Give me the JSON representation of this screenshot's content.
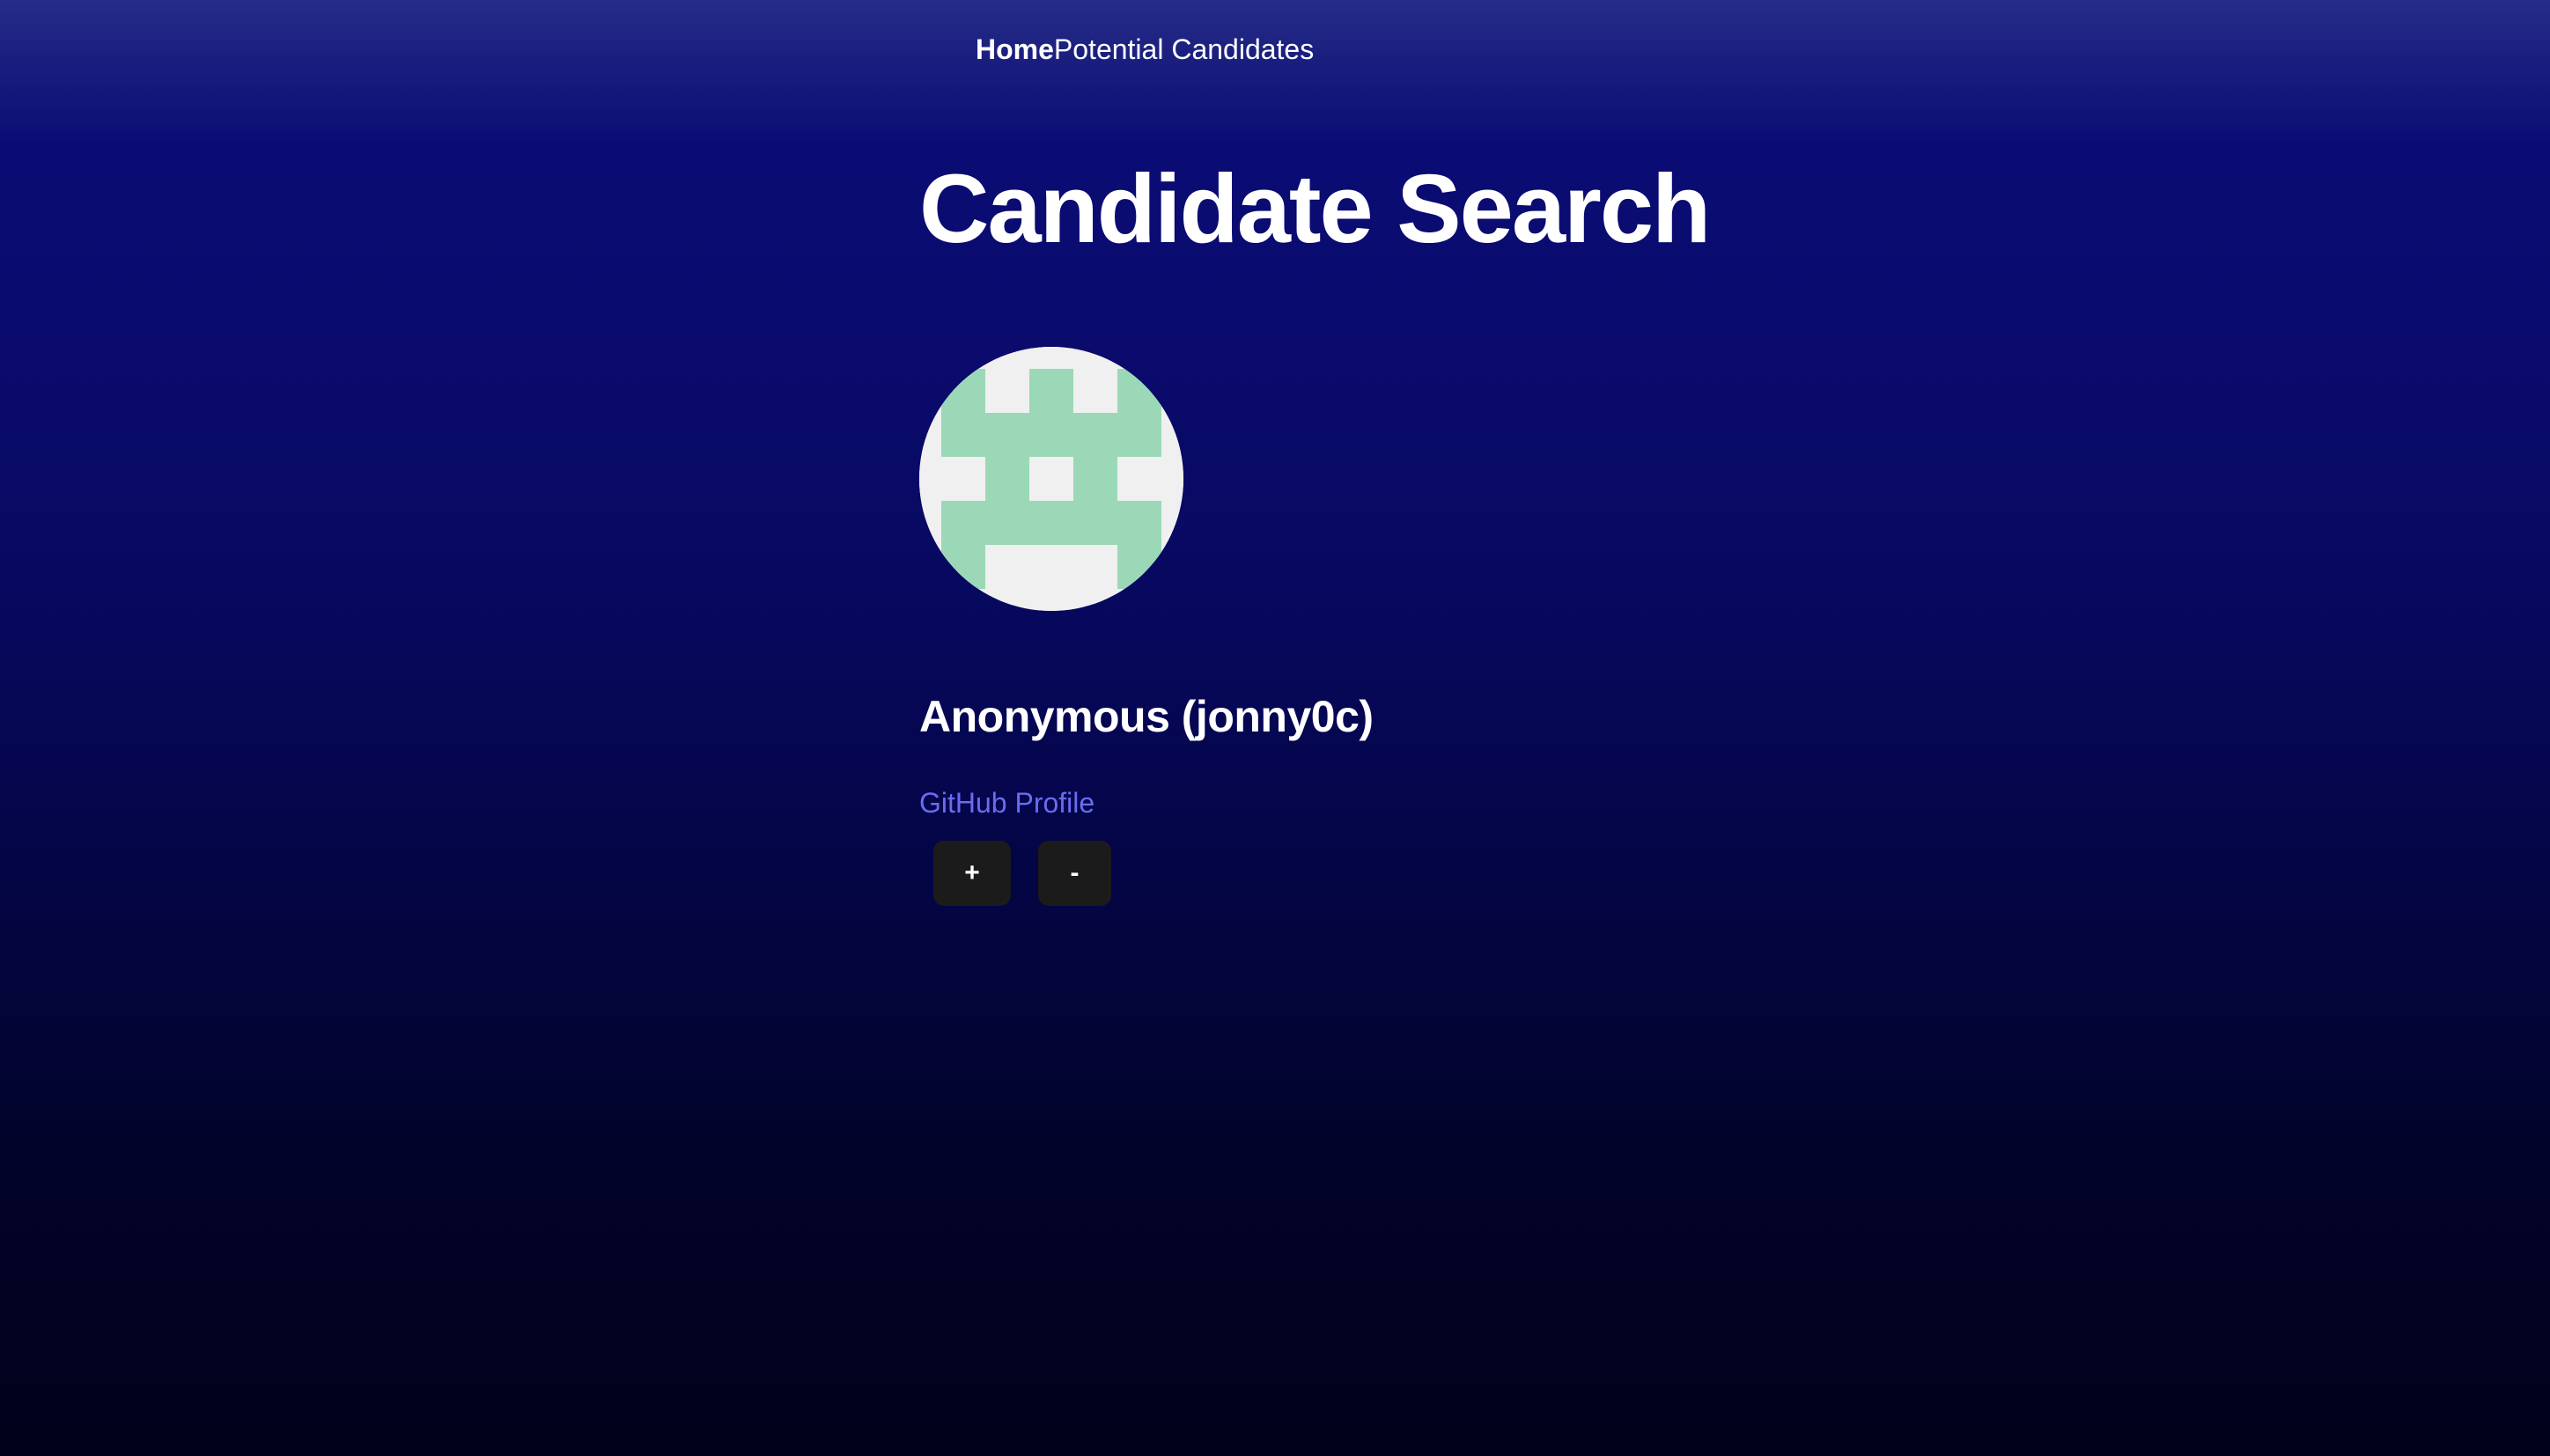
{
  "nav": {
    "home_label": "Home",
    "candidates_label": "Potential Candidates"
  },
  "page": {
    "title": "Candidate Search"
  },
  "candidate": {
    "avatar_icon": "identicon-avatar",
    "name": "Anonymous (jonny0c)",
    "profile_link_label": "GitHub Profile"
  },
  "actions": {
    "add_label": "+",
    "skip_label": "-"
  },
  "colors": {
    "link": "#6a6cf0",
    "button_bg": "#1b1b1b",
    "identicon_fill": "#9bd8b7",
    "identicon_bg": "#f0f0f0"
  }
}
